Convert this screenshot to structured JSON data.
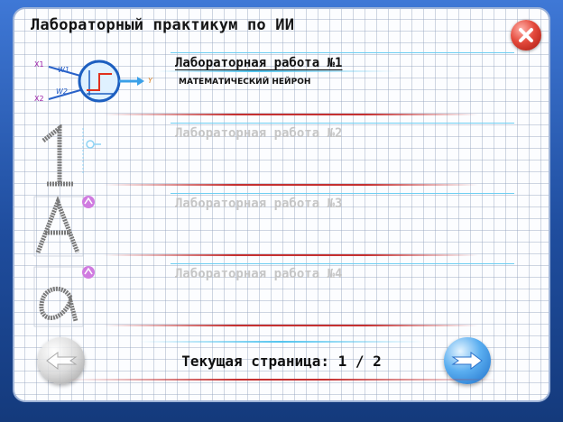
{
  "app": {
    "title": "Лабораторный практикум по ИИ"
  },
  "labs": [
    {
      "title": "Лабораторная работа №1",
      "subtitle": "МАТЕМАТИЧЕСКИЙ НЕЙРОН",
      "active": true,
      "thumb_labels": {
        "x1": "X1",
        "x2": "X2",
        "w1": "W1",
        "w2": "W2",
        "y": "Y"
      }
    },
    {
      "title": "Лабораторная работа №2",
      "active": false,
      "thumb_glyph": "1"
    },
    {
      "title": "Лабораторная работа №3",
      "active": false,
      "thumb_glyph": "A"
    },
    {
      "title": "Лабораторная работа №4",
      "active": false,
      "thumb_glyph": "α"
    }
  ],
  "footer": {
    "page_label": "Текущая страница: 1 / 2"
  },
  "icons": {
    "close": "close-icon",
    "prev": "arrow-left-icon",
    "next": "arrow-right-icon"
  },
  "colors": {
    "frame_blue": "#2d5fb0",
    "accent_red": "#c53030",
    "accent_cyan": "#52c4ee",
    "inactive_text": "#c6c6c6"
  }
}
